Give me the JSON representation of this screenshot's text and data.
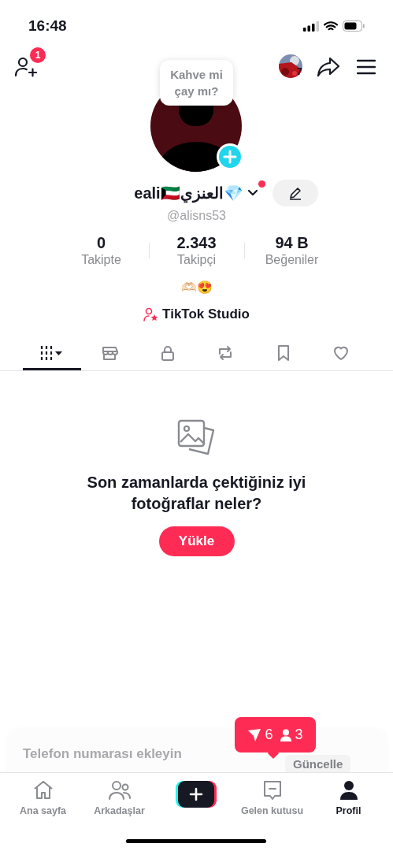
{
  "status_bar": {
    "time": "16:48"
  },
  "header": {
    "add_friend_badge": "1",
    "story_count": "7"
  },
  "note": {
    "text": "Kahve mi çay mı?"
  },
  "profile": {
    "name": "eali🇰🇼العنزي💎",
    "has_new": true,
    "handle": "@alisns53",
    "bio": "🫶🏻😍",
    "studio_label": "TikTok Studio"
  },
  "stats": [
    {
      "value": "0",
      "label": "Takipte"
    },
    {
      "value": "2.343",
      "label": "Takipçi"
    },
    {
      "value": "94 B",
      "label": "Beğeniler"
    }
  ],
  "content_tabs": [
    {
      "kind": "grid",
      "selected": true
    },
    {
      "kind": "shop",
      "selected": false
    },
    {
      "kind": "lock",
      "selected": false
    },
    {
      "kind": "repost",
      "selected": false
    },
    {
      "kind": "bookmark",
      "selected": false
    },
    {
      "kind": "heart",
      "selected": false
    }
  ],
  "empty_state": {
    "message": "Son zamanlarda çektiğiniz iyi fotoğraflar neler?",
    "button": "Yükle"
  },
  "phone_card": {
    "title": "Telefon numarası ekleyin",
    "button": "Güncelle"
  },
  "inbox_popup": {
    "messages": "6",
    "followers": "3"
  },
  "nav": [
    {
      "kind": "home",
      "label": "Ana sayfa",
      "selected": false
    },
    {
      "kind": "friends",
      "label": "Arkadaşlar",
      "selected": false
    },
    {
      "kind": "create"
    },
    {
      "kind": "inbox",
      "label": "Gelen kutusu",
      "selected": false
    },
    {
      "kind": "profile",
      "label": "Profil",
      "selected": true
    }
  ]
}
